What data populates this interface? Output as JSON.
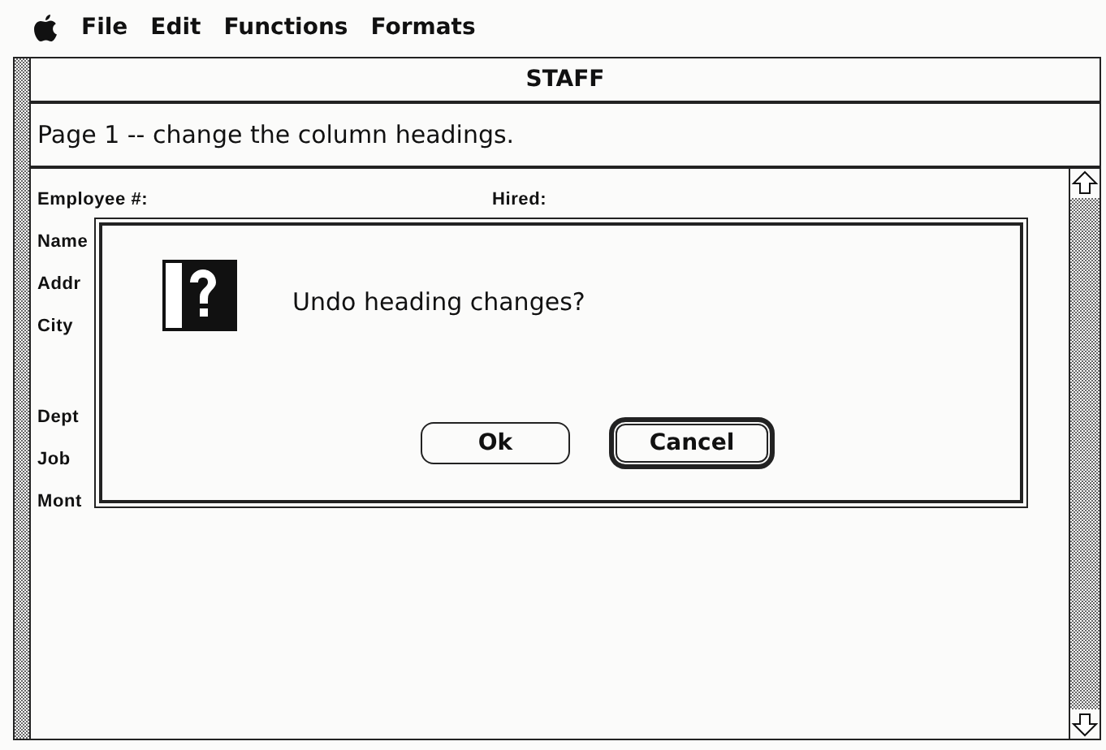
{
  "menu_bar": {
    "items": [
      "File",
      "Edit",
      "Functions",
      "Formats"
    ]
  },
  "window": {
    "title": "STAFF"
  },
  "instruction": "Page 1 -- change the column headings.",
  "form": {
    "rows": [
      {
        "label": "Employee #:",
        "second_label": "Hired:",
        "gap_before": false
      },
      {
        "label": "Name",
        "gap_before": false
      },
      {
        "label": "Addr",
        "gap_before": false
      },
      {
        "label": "City",
        "gap_before": false
      },
      {
        "label": "Dept",
        "gap_before": true
      },
      {
        "label": "Job",
        "gap_before": false
      },
      {
        "label": "Mont",
        "gap_before": false
      }
    ]
  },
  "dialog": {
    "message": "Undo heading changes?",
    "buttons": [
      {
        "label": "Ok",
        "default": false
      },
      {
        "label": "Cancel",
        "default": true
      }
    ]
  }
}
